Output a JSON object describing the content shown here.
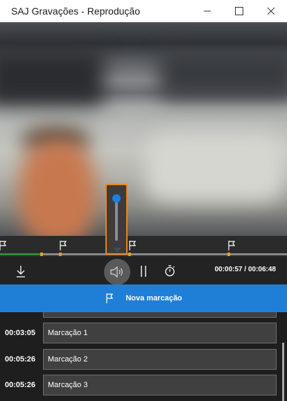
{
  "window": {
    "title": "SAJ Gravações - Reprodução",
    "controls": [
      "minimize-icon",
      "maximize-icon",
      "close-icon"
    ]
  },
  "player": {
    "current_time": "00:00:57",
    "total_time": "00:06:48",
    "time_display": "00:00:57 / 00:06:48",
    "volume_level": 0.88,
    "colors": {
      "accent": "#1f7fd6",
      "marker": "#e6a020",
      "played": "#2e8b3a",
      "focus": "#e8851f"
    }
  },
  "toolbar": {
    "download_icon": "download-icon",
    "volume_icon": "speaker-icon",
    "pause_icon": "pause-icon",
    "timer_icon": "stopwatch-icon"
  },
  "new_marker": {
    "label": "Nova marcação",
    "icon": "flag-icon"
  },
  "bookmarks": [
    {
      "time": "00:03:05",
      "label": "Marcação 1"
    },
    {
      "time": "00:05:26",
      "label": "Marcação 2"
    },
    {
      "time": "00:05:26",
      "label": "Marcação 3"
    }
  ]
}
